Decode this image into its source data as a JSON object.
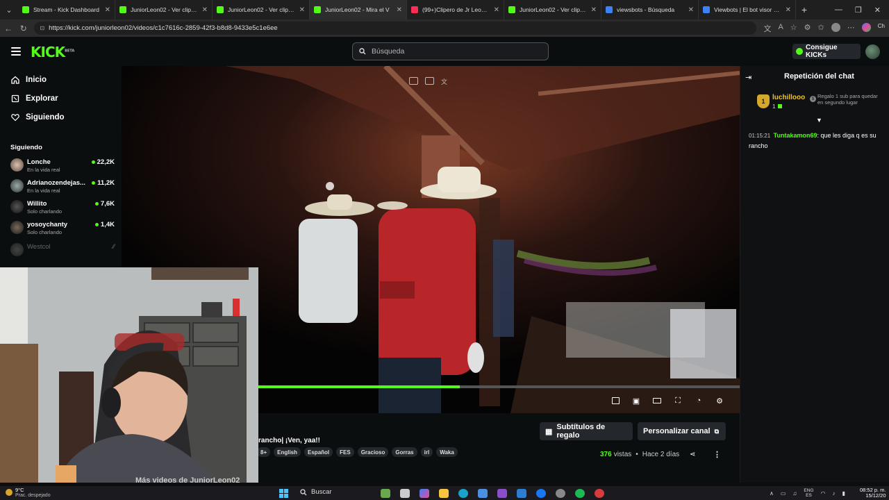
{
  "browser": {
    "tabs": [
      {
        "title": "Stream - Kick Dashboard",
        "favicon_color": "#53fc18"
      },
      {
        "title": "JuniorLeon02 - Ver clips en K",
        "favicon_color": "#53fc18"
      },
      {
        "title": "JuniorLeon02 - Ver clips en K",
        "favicon_color": "#53fc18"
      },
      {
        "title": "JuniorLeon02 - Mira el V",
        "favicon_color": "#53fc18",
        "active": true
      },
      {
        "title": "(99+)Clipero de Jr Leon (@c",
        "favicon_color": "#ff2d55"
      },
      {
        "title": "JuniorLeon02 - Ver clips en K",
        "favicon_color": "#53fc18"
      },
      {
        "title": "viewsbots - Búsqueda",
        "favicon_color": "#3b82f6"
      },
      {
        "title": "Viewbots | El bot visor #1 de",
        "favicon_color": "#3b82f6"
      }
    ],
    "url": "https://kick.com/juniorleon02/videos/c1c7616c-2859-42f3-b8d8-9433e5c1e6ee",
    "profile_label": "Ch"
  },
  "header": {
    "logo": "KICK",
    "logo_badge": "BETA",
    "search_placeholder": "Búsqueda",
    "kicks_label": "Consigue KICKs"
  },
  "sidebar": {
    "nav": [
      {
        "label": "Inicio",
        "icon": "home-icon"
      },
      {
        "label": "Explorar",
        "icon": "compass-icon"
      },
      {
        "label": "Siguiendo",
        "icon": "heart-icon"
      }
    ],
    "following_heading": "Siguiendo",
    "following": [
      {
        "name": "Lonche",
        "category": "En la vida real",
        "viewers": "22,2K"
      },
      {
        "name": "Adrianozendejas...",
        "category": "En la vida real",
        "viewers": "11,2K"
      },
      {
        "name": "Willito",
        "category": "Solo charlando",
        "viewers": "7,6K"
      },
      {
        "name": "yosoychanty",
        "category": "Solo charlando",
        "viewers": "1,4K"
      },
      {
        "name": "Westcol",
        "category": "",
        "viewers": ""
      }
    ]
  },
  "player": {
    "progress": 0.42
  },
  "video": {
    "title_fragment": "rancho| ¡Ven, yaa!!",
    "tags": [
      "8+",
      "English",
      "Español",
      "FES",
      "Gracioso",
      "Gorras",
      "irl",
      "Waka"
    ],
    "views": "376",
    "views_label": "vistas",
    "age": "Hace 2 días",
    "gift_subs_button": "Subtítulos de regalo",
    "customize_button": "Personalizar canal",
    "more_videos": "Más videos de JuniorLeon02"
  },
  "chat": {
    "title": "Repetición del chat",
    "gifter": {
      "rank": "1",
      "name": "luchillooo",
      "count": "1",
      "description": "Regalo 1 sub para quedar en segundo lugar"
    },
    "messages": [
      {
        "time": "01:15:21",
        "user": "Tuntakamon69",
        "text": "que les diga q es su rancho"
      }
    ]
  },
  "taskbar": {
    "temp": "9°C",
    "weather": "Prac. despejado",
    "search_label": "Buscar",
    "lang": "ENG",
    "lang_sub": "ES",
    "time": "08:52 p. m.",
    "date": "15/12/20"
  },
  "colors": {
    "accent": "#53fc18",
    "gold": "#f0c42b",
    "bg": "#0b0e0f"
  }
}
